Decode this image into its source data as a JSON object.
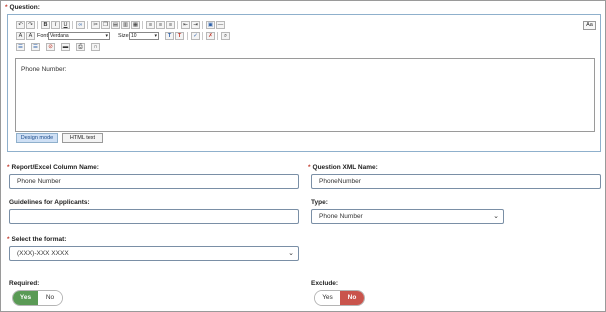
{
  "question": {
    "label": "Question:",
    "required_marker": "*",
    "font_label": "Font",
    "font_value": "Verdana",
    "size_label": "Size",
    "size_value": "10",
    "aa_label": "Aa",
    "editor_content": "Phone Number:",
    "design_mode_label": "Design mode",
    "html_text_label": "HTML text"
  },
  "toolbar_icons": [
    "undo-icon",
    "redo-icon",
    "bold-icon",
    "italic-icon",
    "underline-icon",
    "link-icon",
    "cut-icon",
    "copy-icon",
    "paste-icon",
    "paste-text-icon",
    "align-left-icon",
    "align-center-icon",
    "align-right-icon",
    "outdent-icon",
    "indent-icon",
    "image-icon",
    "horizontal-rule-icon",
    "fore-color-icon",
    "back-color-icon",
    "superscript-icon",
    "subscript-icon",
    "spellcheck-icon",
    "remove-format-icon",
    "zoom-icon",
    "numbered-list-icon",
    "bullet-list-icon",
    "clear-icon",
    "table-icon",
    "print-icon",
    "headphones-icon"
  ],
  "report_column": {
    "label": "Report/Excel Column Name:",
    "required_marker": "*",
    "value": "Phone Number"
  },
  "xml_name": {
    "label": "Question XML Name:",
    "required_marker": "*",
    "value": "PhoneNumber"
  },
  "guidelines": {
    "label": "Guidelines for Applicants:",
    "value": ""
  },
  "type": {
    "label": "Type:",
    "value": "Phone Number"
  },
  "format": {
    "label": "Select the format:",
    "required_marker": "*",
    "value": "(XXX)-XXX XXXX"
  },
  "required": {
    "label": "Required:",
    "yes": "Yes",
    "no": "No",
    "selected": "Yes"
  },
  "exclude": {
    "label": "Exclude:",
    "yes": "Yes",
    "no": "No",
    "selected": "No"
  },
  "colors": {
    "yes_active": "#5a9a55",
    "no_active": "#c9544c",
    "required_marker": "#c0392b",
    "editor_border": "#8fb0cc"
  }
}
